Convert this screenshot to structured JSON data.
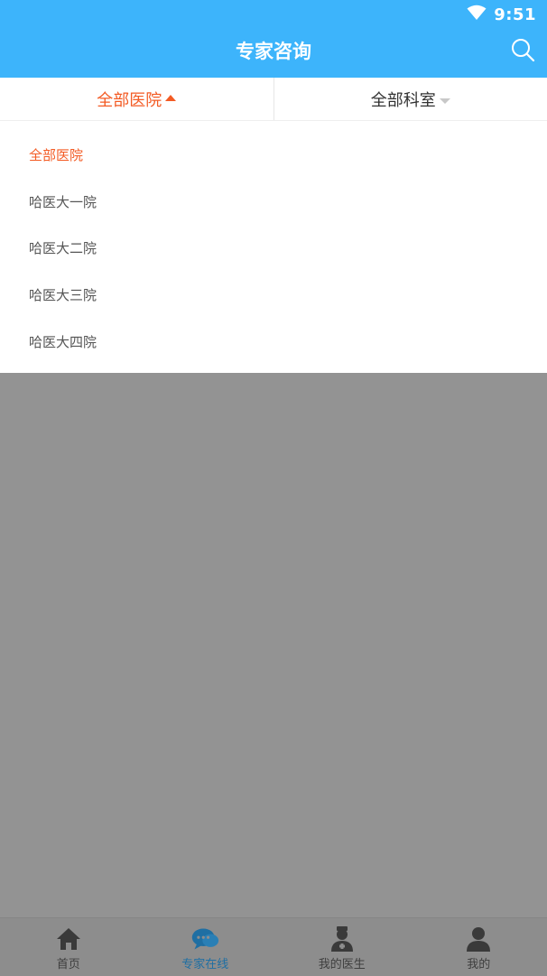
{
  "status": {
    "time": "9:51",
    "wifi_icon": "wifi-icon"
  },
  "header": {
    "title": "专家咨询",
    "search_icon": "search-icon"
  },
  "filters": {
    "hospital": "全部医院",
    "department": "全部科室"
  },
  "dropdown": {
    "items": [
      {
        "label": "全部医院",
        "selected": true
      },
      {
        "label": "哈医大一院",
        "selected": false
      },
      {
        "label": "哈医大二院",
        "selected": false
      },
      {
        "label": "哈医大三院",
        "selected": false
      },
      {
        "label": "哈医大四院",
        "selected": false
      }
    ]
  },
  "tabs": [
    {
      "label": "首页",
      "icon": "home-icon",
      "active": false
    },
    {
      "label": "专家在线",
      "icon": "chat-icon",
      "active": true
    },
    {
      "label": "我的医生",
      "icon": "doctor-icon",
      "active": false
    },
    {
      "label": "我的",
      "icon": "user-icon",
      "active": false
    }
  ],
  "colors": {
    "brand": "#3db4fb",
    "accent": "#f35b24",
    "active_tab": "#1f6fa3"
  }
}
